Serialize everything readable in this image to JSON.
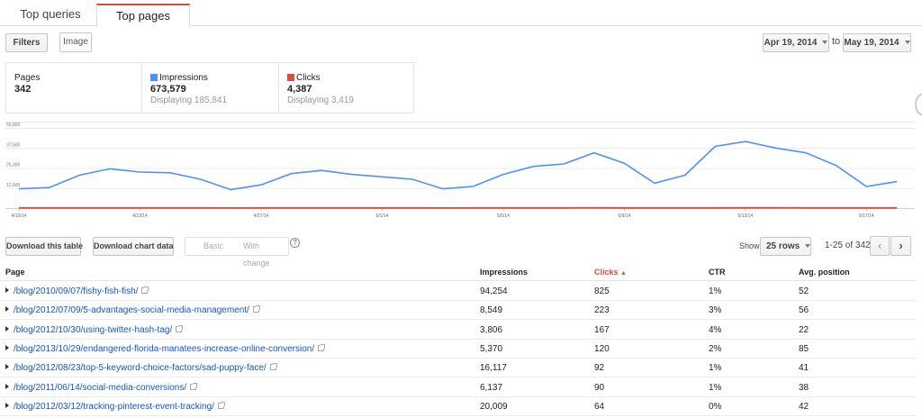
{
  "tabs": [
    {
      "label": "Top queries",
      "active": false
    },
    {
      "label": "Top pages",
      "active": true
    }
  ],
  "toolbar": {
    "filters_label": "Filters",
    "image_label": "Image",
    "date_from": "Apr 19, 2014",
    "date_to_sep": "to",
    "date_to": "May 19, 2014"
  },
  "summary": {
    "pages": {
      "label": "Pages",
      "value": "342"
    },
    "impressions": {
      "label": "Impressions",
      "value": "673,579",
      "sub": "Displaying 185,841",
      "color": "#4d90fe"
    },
    "clicks": {
      "label": "Clicks",
      "value": "4,387",
      "sub": "Displaying 3,419",
      "color": "#dd4b39"
    }
  },
  "chart_data": {
    "type": "line",
    "x": [
      "4/19/14",
      "4/20/14",
      "4/21/14",
      "4/22/14",
      "4/23/14",
      "4/24/14",
      "4/25/14",
      "4/26/14",
      "4/27/14",
      "4/28/14",
      "4/29/14",
      "4/30/14",
      "5/1/14",
      "5/2/14",
      "5/3/14",
      "5/4/14",
      "5/5/14",
      "5/6/14",
      "5/7/14",
      "5/8/14",
      "5/9/14",
      "5/10/14",
      "5/11/14",
      "5/12/14",
      "5/13/14",
      "5/14/14",
      "5/15/14",
      "5/16/14",
      "5/17/14",
      "5/18/14"
    ],
    "x_tick_labels": [
      "4/19/14",
      "4/23/14",
      "4/27/14",
      "5/1/14",
      "5/5/14",
      "5/9/14",
      "5/13/14",
      "5/17/14"
    ],
    "y_tick_labels": [
      "12,500",
      "25,000",
      "37,500",
      "50,000"
    ],
    "ylim": [
      0,
      50000
    ],
    "grid": true,
    "series": [
      {
        "name": "Impressions",
        "color": "#4d90fe",
        "values": [
          12000,
          12800,
          20500,
          24500,
          22500,
          22000,
          18000,
          11500,
          14500,
          21500,
          23500,
          21000,
          19500,
          18000,
          12000,
          13500,
          21000,
          26000,
          27500,
          34500,
          28000,
          15500,
          20500,
          38500,
          41500,
          37500,
          34500,
          26500,
          13500,
          16500
        ]
      },
      {
        "name": "Clicks",
        "color": "#dd4b39",
        "values": [
          110,
          118,
          130,
          125,
          122,
          120,
          105,
          70,
          90,
          115,
          120,
          118,
          110,
          108,
          80,
          95,
          120,
          130,
          135,
          150,
          125,
          95,
          110,
          140,
          150,
          145,
          135,
          120,
          90,
          95
        ]
      }
    ]
  },
  "actions": {
    "download_table": "Download this table",
    "download_chart": "Download chart data",
    "basic": "Basic",
    "with_change": "With change",
    "help": "?",
    "show_label": "Show",
    "rows_select": "25 rows",
    "pagination": "1-25 of 342"
  },
  "table": {
    "headers": {
      "page": "Page",
      "impressions": "Impressions",
      "clicks": "Clicks",
      "ctr": "CTR",
      "avg_position": "Avg. position"
    },
    "sort_color": "#dd4b39",
    "rows": [
      {
        "page": "/blog/2010/09/07/fishy-fish-fish/",
        "impressions": "94,254",
        "clicks": "825",
        "ctr": "1%",
        "avg_position": "52"
      },
      {
        "page": "/blog/2012/07/09/5-advantages-social-media-management/",
        "impressions": "8,549",
        "clicks": "223",
        "ctr": "3%",
        "avg_position": "56"
      },
      {
        "page": "/blog/2012/10/30/using-twitter-hash-tag/",
        "impressions": "3,806",
        "clicks": "167",
        "ctr": "4%",
        "avg_position": "22"
      },
      {
        "page": "/blog/2013/10/29/endangered-florida-manatees-increase-online-conversion/",
        "impressions": "5,370",
        "clicks": "120",
        "ctr": "2%",
        "avg_position": "85"
      },
      {
        "page": "/blog/2012/08/23/top-5-keyword-choice-factors/sad-puppy-face/",
        "impressions": "16,117",
        "clicks": "92",
        "ctr": "1%",
        "avg_position": "41"
      },
      {
        "page": "/blog/2011/06/14/social-media-conversions/",
        "impressions": "6,137",
        "clicks": "90",
        "ctr": "1%",
        "avg_position": "38"
      },
      {
        "page": "/blog/2012/03/12/tracking-pinterest-event-tracking/",
        "impressions": "20,009",
        "clicks": "64",
        "ctr": "0%",
        "avg_position": "42"
      }
    ]
  }
}
